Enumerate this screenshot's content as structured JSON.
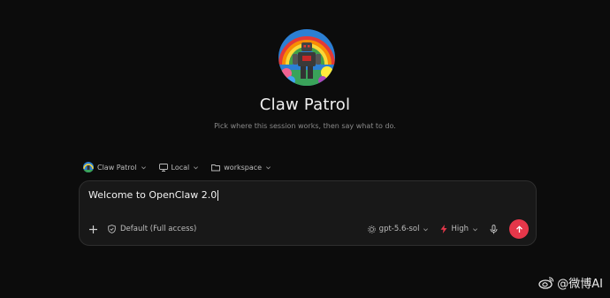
{
  "agent": {
    "name": "Claw Patrol",
    "subtitle": "Pick where this session works, then say what to do."
  },
  "context_bar": {
    "agent_label": "Claw Patrol",
    "location_label": "Local",
    "folder_label": "workspace"
  },
  "composer": {
    "input_value": "Welcome to OpenClaw 2.0",
    "permission_label": "Default (Full access)",
    "model_label": "gpt-5.6-sol",
    "effort_label": "High"
  },
  "watermark": {
    "text": "@微博AI"
  },
  "colors": {
    "background": "#0c0c0c",
    "composer_bg": "#181818",
    "send_button": "#e5374a",
    "effort_icon": "#e5374a"
  },
  "icons": [
    "robot-avatar",
    "monitor-icon",
    "folder-icon",
    "plus-icon",
    "shield-icon",
    "chip-icon",
    "bolt-icon",
    "mic-icon",
    "arrow-up-icon",
    "weibo-icon"
  ]
}
